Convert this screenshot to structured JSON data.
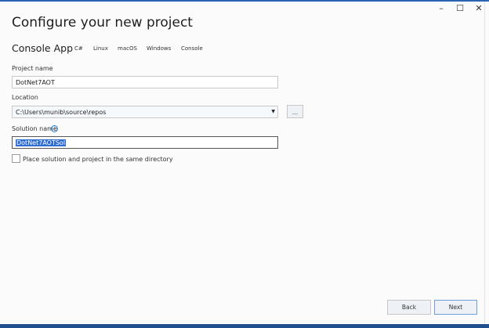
{
  "window": {
    "controls": [
      "minimize",
      "maximize",
      "close"
    ]
  },
  "title": "Configure your new project",
  "template": {
    "name": "Console App",
    "tags": [
      "C#",
      "Linux",
      "macOS",
      "Windows",
      "Console"
    ]
  },
  "project_name": {
    "label": "Project name",
    "value": "DotNet7AOT"
  },
  "location": {
    "label": "Location",
    "value": "C:\\Users\\munib\\source\\repos",
    "browse_label": "..."
  },
  "solution_name": {
    "label": "Solution name",
    "value": "DotNet7AOTSol",
    "info_icon": "i"
  },
  "same_dir": {
    "label": "Place solution and project in the same directory",
    "checked": false
  },
  "footer": {
    "back": "Back",
    "next": "Next"
  }
}
